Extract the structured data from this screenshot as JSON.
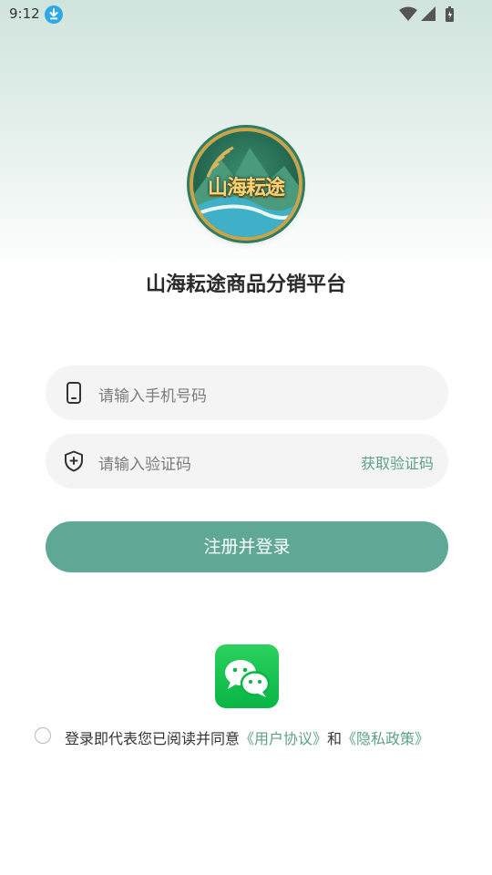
{
  "status_bar": {
    "time": "9:12",
    "icons": [
      "download-icon",
      "wifi-icon",
      "signal-icon",
      "battery-icon"
    ]
  },
  "logo": {
    "text": "山海耘途"
  },
  "app_title": "山海耘途商品分销平台",
  "form": {
    "phone": {
      "placeholder": "请输入手机号码",
      "icon": "phone-icon"
    },
    "code": {
      "placeholder": "请输入验证码",
      "icon": "shield-icon",
      "get_code_label": "获取验证码"
    },
    "submit_label": "注册并登录"
  },
  "wechat": {
    "icon": "wechat-icon"
  },
  "agreement": {
    "checked": false,
    "prefix": "登录即代表您已阅读并同意",
    "user_agreement": "《用户协议》",
    "conjunction": "和",
    "privacy_policy": "《隐私政策》"
  },
  "colors": {
    "accent": "#5fa896",
    "link": "#5e9f8a",
    "wechat": "#09b546"
  }
}
